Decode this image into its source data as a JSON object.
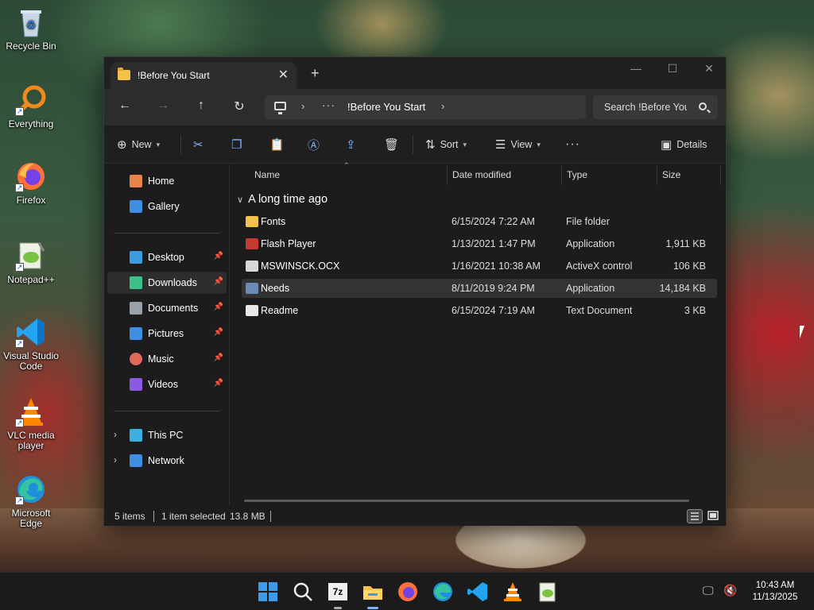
{
  "desktop": {
    "icons": [
      {
        "label": "Recycle Bin",
        "icon": "recycle-bin-icon"
      },
      {
        "label": "Everything",
        "icon": "everything-search-icon"
      },
      {
        "label": "Firefox",
        "icon": "firefox-icon"
      },
      {
        "label": "Notepad++",
        "icon": "notepad-plus-plus-icon"
      },
      {
        "label": "Visual Studio Code",
        "icon": "vscode-icon"
      },
      {
        "label": "VLC media player",
        "icon": "vlc-icon"
      },
      {
        "label": "Microsoft Edge",
        "icon": "edge-icon"
      }
    ]
  },
  "window": {
    "tab_title": "!Before You Start",
    "tab_close": "✕",
    "new_tab": "+",
    "controls": {
      "minimize": "—",
      "maximize": "☐",
      "close": "✕"
    },
    "nav": {
      "back": "←",
      "forward": "→",
      "up": "↑",
      "refresh": "↻"
    },
    "address": {
      "ellipsis": "···",
      "crumb": "!Before You Start",
      "sep": "›"
    },
    "search_placeholder": "Search !Before You Start",
    "toolbar": {
      "new_label": "New",
      "sort_label": "Sort",
      "view_label": "View",
      "more_label": "···",
      "details_label": "Details"
    },
    "sidebar": {
      "top": [
        {
          "label": "Home",
          "color": "#e8834a"
        },
        {
          "label": "Gallery",
          "color": "#3d8ee0"
        }
      ],
      "quick": [
        {
          "label": "Desktop",
          "color": "#3d9be0",
          "pinned": true
        },
        {
          "label": "Downloads",
          "color": "#3dc08a",
          "pinned": true,
          "selected": true
        },
        {
          "label": "Documents",
          "color": "#9aa0a8",
          "pinned": true
        },
        {
          "label": "Pictures",
          "color": "#3d8ee0",
          "pinned": true
        },
        {
          "label": "Music",
          "color": "#e06a5a",
          "pinned": true
        },
        {
          "label": "Videos",
          "color": "#8a5ae0",
          "pinned": true
        }
      ],
      "bottom": [
        {
          "label": "This PC",
          "color": "#3db0e0"
        },
        {
          "label": "Network",
          "color": "#3d8ee0"
        }
      ],
      "pin_glyph": "📌",
      "expand_glyph": "›"
    },
    "columns": {
      "name": "Name",
      "date": "Date modified",
      "type": "Type",
      "size": "Size"
    },
    "group_label": "A long time ago",
    "files": [
      {
        "name": "Fonts",
        "date": "6/15/2024 7:22 AM",
        "type": "File folder",
        "size": "",
        "color": "#f4c24a"
      },
      {
        "name": "Flash Player",
        "date": "1/13/2021 1:47 PM",
        "type": "Application",
        "size": "1,911 KB",
        "color": "#c23a30"
      },
      {
        "name": "MSWINSCK.OCX",
        "date": "1/16/2021 10:38 AM",
        "type": "ActiveX control",
        "size": "106 KB",
        "color": "#d8d8d8"
      },
      {
        "name": "Needs",
        "date": "8/11/2019 9:24 PM",
        "type": "Application",
        "size": "14,184 KB",
        "color": "#6a8ab8",
        "selected": true
      },
      {
        "name": "Readme",
        "date": "6/15/2024 7:19 AM",
        "type": "Text Document",
        "size": "3 KB",
        "color": "#e8e8e8"
      }
    ],
    "status": {
      "items": "5 items",
      "selected": "1 item selected",
      "size": "13.8 MB"
    }
  },
  "taskbar": {
    "apps": [
      "start-icon",
      "search-icon",
      "7zip-icon",
      "file-explorer-icon",
      "firefox-icon",
      "edge-icon",
      "vscode-icon",
      "vlc-icon",
      "notepad-plus-plus-icon"
    ],
    "seven_zip_label": "7z",
    "time": "10:43 AM",
    "date": "11/13/2025"
  }
}
